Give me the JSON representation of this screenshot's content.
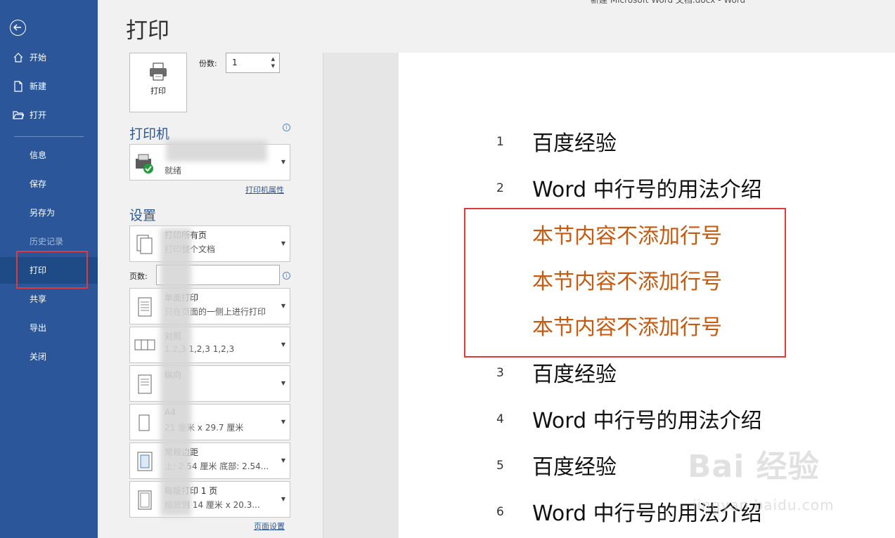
{
  "window": {
    "title": "新建 Microsoft Word 文档.docx  -  Word"
  },
  "sidebar": {
    "back_icon": "back-arrow-icon",
    "items": [
      {
        "label": "开始",
        "icon": "home-icon"
      },
      {
        "label": "新建",
        "icon": "new-document-icon"
      },
      {
        "label": "打开",
        "icon": "folder-open-icon"
      },
      {
        "label": "信息"
      },
      {
        "label": "保存"
      },
      {
        "label": "另存为"
      },
      {
        "label": "历史记录",
        "disabled": true
      },
      {
        "label": "打印",
        "active": true
      },
      {
        "label": "共享"
      },
      {
        "label": "导出"
      },
      {
        "label": "关闭"
      }
    ]
  },
  "header": {
    "title": "打印"
  },
  "print_panel": {
    "print_button_label": "打印",
    "copies_label": "份数:",
    "copies_value": "1",
    "printer_heading": "打印机",
    "printer_status": "就绪",
    "printer_properties_link": "打印机属性",
    "settings_heading": "设置",
    "settings": [
      {
        "line1": "打印所有页",
        "line2": "打印整个文档"
      },
      {
        "line1": "单面打印",
        "line2": "只在页面的一侧上进行打印"
      },
      {
        "line1": "对照",
        "line2": "1,2,3    1,2,3    1,2,3"
      },
      {
        "line1": "纵向",
        "line2": ""
      },
      {
        "line1": "A4",
        "line2": "21 厘米 x 29.7 厘米"
      },
      {
        "line1": "常规边距",
        "line2": "上: 2.54 厘米 底部: 2.54..."
      },
      {
        "line1": "每版打印 1 页",
        "line2": "缩放到 14 厘米 x 20.3..."
      }
    ],
    "pages_label": "页数:",
    "pages_value": "",
    "page_setup_link": "页面设置"
  },
  "preview": {
    "lines": [
      {
        "num": "1",
        "text": "百度经验"
      },
      {
        "num": "2",
        "text": "Word 中行号的用法介绍"
      },
      {
        "num": "",
        "text": "本节内容不添加行号",
        "highlight": true
      },
      {
        "num": "",
        "text": "本节内容不添加行号",
        "highlight": true
      },
      {
        "num": "",
        "text": "本节内容不添加行号",
        "highlight": true
      },
      {
        "num": "3",
        "text": "百度经验"
      },
      {
        "num": "4",
        "text": "Word 中行号的用法介绍"
      },
      {
        "num": "5",
        "text": "百度经验"
      },
      {
        "num": "6",
        "text": "Word 中行号的用法介绍"
      }
    ],
    "highlight_color": "#c55a11"
  },
  "watermark": {
    "text": "Bai 经验",
    "sub": "jingyan.baidu.com"
  },
  "colors": {
    "sidebar": "#2b579a",
    "accent_red": "#e0393b"
  }
}
